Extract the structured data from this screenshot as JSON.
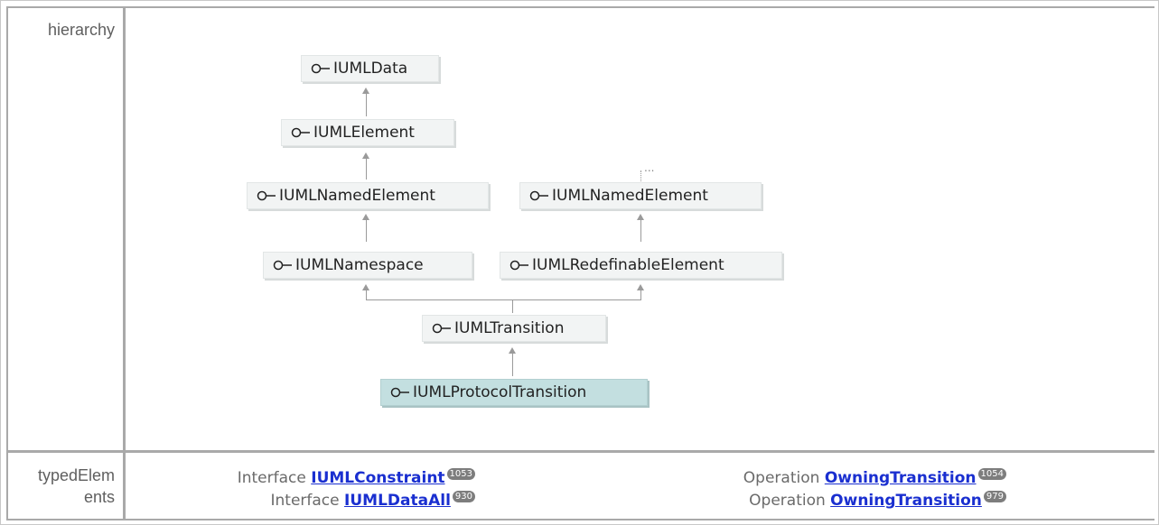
{
  "sections": {
    "hierarchy_label": "hierarchy",
    "typed_label_line1": "typedElem",
    "typed_label_line2": "ents"
  },
  "hierarchy": {
    "nodes": {
      "uml_data": "IUMLData",
      "uml_element": "IUMLElement",
      "named_left": "IUMLNamedElement",
      "named_right": "IUMLNamedElement",
      "namespace": "IUMLNamespace",
      "redefinable": "IUMLRedefinableElement",
      "transition": "IUMLTransition",
      "protocol_transition": "IUMLProtocolTransition"
    },
    "more_indicator": "..."
  },
  "typed_elements": [
    {
      "kind": "Interface",
      "name": "IUMLConstraint",
      "count": "1053"
    },
    {
      "kind": "Interface",
      "name": "IUMLDataAll",
      "count": "930"
    },
    {
      "kind": "Operation",
      "name": "OwningTransition",
      "count": "1054"
    },
    {
      "kind": "Operation",
      "name": "OwningTransition",
      "count": "979"
    }
  ],
  "colors": {
    "selected_node": "#c3dfe0",
    "node": "#f2f4f4",
    "link": "#1a2fd0",
    "badge": "#7d7d7d"
  }
}
